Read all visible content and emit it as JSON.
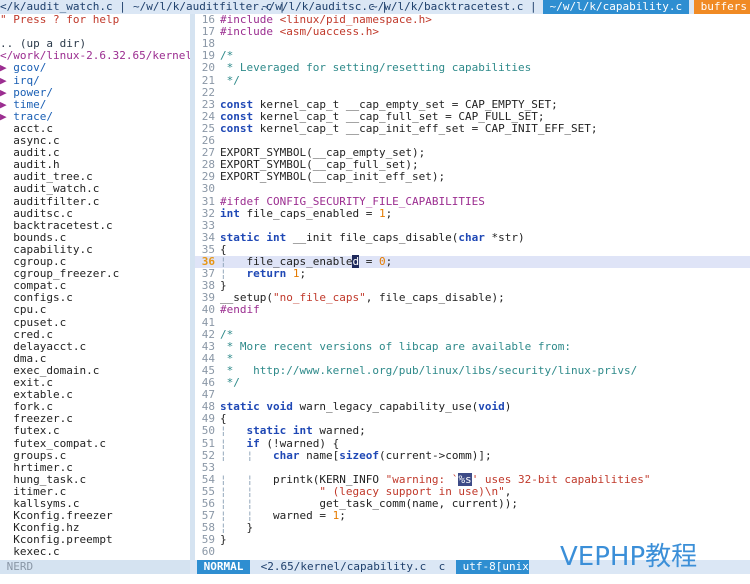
{
  "tabs": [
    "</k/audit_watch.c | ",
    "~/w/l/k/auditfilter.c | ",
    "~/w/l/k/auditsc.c | ",
    "~/w/l/k/backtracetest.c | ",
    " ~/w/l/k/capability.c ",
    " buffers "
  ],
  "tree": {
    "help": "\" Press ? for help",
    "updir": ".. (up a dir)",
    "cwd": "</work/linux-2.6.32.65/kernel/",
    "dirs": [
      "gcov/",
      "irq/",
      "power/",
      "time/",
      "trace/"
    ],
    "files": [
      "acct.c",
      "async.c",
      "audit.c",
      "audit.h",
      "audit_tree.c",
      "audit_watch.c",
      "auditfilter.c",
      "auditsc.c",
      "backtracetest.c",
      "bounds.c",
      "capability.c",
      "cgroup.c",
      "cgroup_freezer.c",
      "compat.c",
      "configs.c",
      "cpu.c",
      "cpuset.c",
      "cred.c",
      "delayacct.c",
      "dma.c",
      "exec_domain.c",
      "exit.c",
      "extable.c",
      "fork.c",
      "freezer.c",
      "futex.c",
      "futex_compat.c",
      "groups.c",
      "hrtimer.c",
      "hung_task.c",
      "itimer.c",
      "kallsyms.c",
      "Kconfig.freezer",
      "Kconfig.hz",
      "Kconfig.preempt",
      "kexec.c"
    ]
  },
  "code": [
    {
      "n": "16",
      "t": [
        [
          "pp",
          "#include "
        ],
        [
          "str",
          "<linux/pid_namespace.h>"
        ]
      ]
    },
    {
      "n": "17",
      "t": [
        [
          "pp",
          "#include "
        ],
        [
          "str",
          "<asm/uaccess.h>"
        ]
      ]
    },
    {
      "n": "18",
      "t": []
    },
    {
      "n": "19",
      "t": [
        [
          "cm",
          "/*"
        ]
      ]
    },
    {
      "n": "20",
      "t": [
        [
          "cm",
          " * Leveraged for setting/resetting capabilities"
        ]
      ]
    },
    {
      "n": "21",
      "t": [
        [
          "cm",
          " */"
        ]
      ]
    },
    {
      "n": "22",
      "t": []
    },
    {
      "n": "23",
      "t": [
        [
          "kw",
          "const"
        ],
        [
          "fn",
          " kernel_cap_t __cap_empty_set = CAP_EMPTY_SET;"
        ]
      ]
    },
    {
      "n": "24",
      "t": [
        [
          "kw",
          "const"
        ],
        [
          "fn",
          " kernel_cap_t __cap_full_set = CAP_FULL_SET;"
        ]
      ]
    },
    {
      "n": "25",
      "t": [
        [
          "kw",
          "const"
        ],
        [
          "fn",
          " kernel_cap_t __cap_init_eff_set = CAP_INIT_EFF_SET;"
        ]
      ]
    },
    {
      "n": "26",
      "t": []
    },
    {
      "n": "27",
      "t": [
        [
          "fn",
          "EXPORT_SYMBOL(__cap_empty_set);"
        ]
      ]
    },
    {
      "n": "28",
      "t": [
        [
          "fn",
          "EXPORT_SYMBOL(__cap_full_set);"
        ]
      ]
    },
    {
      "n": "29",
      "t": [
        [
          "fn",
          "EXPORT_SYMBOL(__cap_init_eff_set);"
        ]
      ]
    },
    {
      "n": "30",
      "t": []
    },
    {
      "n": "31",
      "t": [
        [
          "pp",
          "#ifdef CONFIG_SECURITY_FILE_CAPABILITIES"
        ]
      ]
    },
    {
      "n": "32",
      "t": [
        [
          "kw",
          "int"
        ],
        [
          "fn",
          " file_caps_enabled = "
        ],
        [
          "num",
          "1"
        ],
        [
          "fn",
          ";"
        ]
      ]
    },
    {
      "n": "33",
      "t": []
    },
    {
      "n": "34",
      "t": [
        [
          "kw",
          "static int"
        ],
        [
          "fn",
          " __init file_caps_disable("
        ],
        [
          "kw",
          "char"
        ],
        [
          "fn",
          " *str)"
        ]
      ]
    },
    {
      "n": "35",
      "t": [
        [
          "fn",
          "{"
        ]
      ]
    },
    {
      "n": "36",
      "cur": true,
      "t": [
        [
          "guide",
          "¦"
        ],
        [
          "fn",
          "   file_caps_enable"
        ],
        [
          "cursor",
          "d"
        ],
        [
          "fn",
          " = "
        ],
        [
          "num",
          "0"
        ],
        [
          "fn",
          ";"
        ]
      ]
    },
    {
      "n": "37",
      "t": [
        [
          "guide",
          "¦"
        ],
        [
          "fn",
          "   "
        ],
        [
          "kw",
          "return"
        ],
        [
          "fn",
          " "
        ],
        [
          "num",
          "1"
        ],
        [
          "fn",
          ";"
        ]
      ]
    },
    {
      "n": "38",
      "t": [
        [
          "fn",
          "}"
        ]
      ]
    },
    {
      "n": "39",
      "t": [
        [
          "fn",
          "__setup("
        ],
        [
          "str",
          "\"no_file_caps\""
        ],
        [
          "fn",
          ", file_caps_disable);"
        ]
      ]
    },
    {
      "n": "40",
      "t": [
        [
          "pp",
          "#endif"
        ]
      ]
    },
    {
      "n": "41",
      "t": []
    },
    {
      "n": "42",
      "t": [
        [
          "cm",
          "/*"
        ]
      ]
    },
    {
      "n": "43",
      "t": [
        [
          "cm",
          " * More recent versions of libcap are available from:"
        ]
      ]
    },
    {
      "n": "44",
      "t": [
        [
          "cm",
          " *"
        ]
      ]
    },
    {
      "n": "45",
      "t": [
        [
          "cm",
          " *   http://www.kernel.org/pub/linux/libs/security/linux-privs/"
        ]
      ]
    },
    {
      "n": "46",
      "t": [
        [
          "cm",
          " */"
        ]
      ]
    },
    {
      "n": "47",
      "t": []
    },
    {
      "n": "48",
      "t": [
        [
          "kw",
          "static void"
        ],
        [
          "fn",
          " warn_legacy_capability_use("
        ],
        [
          "kw",
          "void"
        ],
        [
          "fn",
          ")"
        ]
      ]
    },
    {
      "n": "49",
      "t": [
        [
          "fn",
          "{"
        ]
      ]
    },
    {
      "n": "50",
      "t": [
        [
          "guide",
          "¦"
        ],
        [
          "fn",
          "   "
        ],
        [
          "kw",
          "static int"
        ],
        [
          "fn",
          " warned;"
        ]
      ]
    },
    {
      "n": "51",
      "t": [
        [
          "guide",
          "¦"
        ],
        [
          "fn",
          "   "
        ],
        [
          "kw",
          "if"
        ],
        [
          "fn",
          " (!warned) {"
        ]
      ]
    },
    {
      "n": "52",
      "t": [
        [
          "guide",
          "¦   ¦"
        ],
        [
          "fn",
          "   "
        ],
        [
          "kw",
          "char"
        ],
        [
          "fn",
          " name["
        ],
        [
          "kw",
          "sizeof"
        ],
        [
          "fn",
          "(current->comm)];"
        ]
      ]
    },
    {
      "n": "53",
      "t": []
    },
    {
      "n": "54",
      "t": [
        [
          "guide",
          "¦   ¦"
        ],
        [
          "fn",
          "   printk(KERN_INFO "
        ],
        [
          "str",
          "\"warning: `"
        ],
        [
          "hl",
          "%s"
        ],
        [
          "str",
          "' uses 32-bit capabilities\""
        ]
      ]
    },
    {
      "n": "55",
      "t": [
        [
          "guide",
          "¦   ¦"
        ],
        [
          "fn",
          "          "
        ],
        [
          "str",
          "\" (legacy support in use)\\n\""
        ],
        [
          "fn",
          ","
        ]
      ]
    },
    {
      "n": "56",
      "t": [
        [
          "guide",
          "¦   ¦"
        ],
        [
          "fn",
          "          get_task_comm(name, current));"
        ]
      ]
    },
    {
      "n": "57",
      "t": [
        [
          "guide",
          "¦   ¦"
        ],
        [
          "fn",
          "   warned = "
        ],
        [
          "num",
          "1"
        ],
        [
          "fn",
          ";"
        ]
      ]
    },
    {
      "n": "58",
      "t": [
        [
          "guide",
          "¦"
        ],
        [
          "fn",
          "   }"
        ]
      ]
    },
    {
      "n": "59",
      "t": [
        [
          "fn",
          "}"
        ]
      ]
    },
    {
      "n": "60",
      "t": []
    }
  ],
  "status": {
    "nerd": " NERD ",
    "mode": " NORMAL ",
    "file": " <2.65/kernel/capability.c ",
    "ft": " c ",
    "enc": " utf-8[unix"
  },
  "watermark": "VEPHP教程",
  "colors": {
    "accent": "#2e8ed1",
    "buffers": "#f08a24",
    "tabbg": "#dbe7f5"
  }
}
